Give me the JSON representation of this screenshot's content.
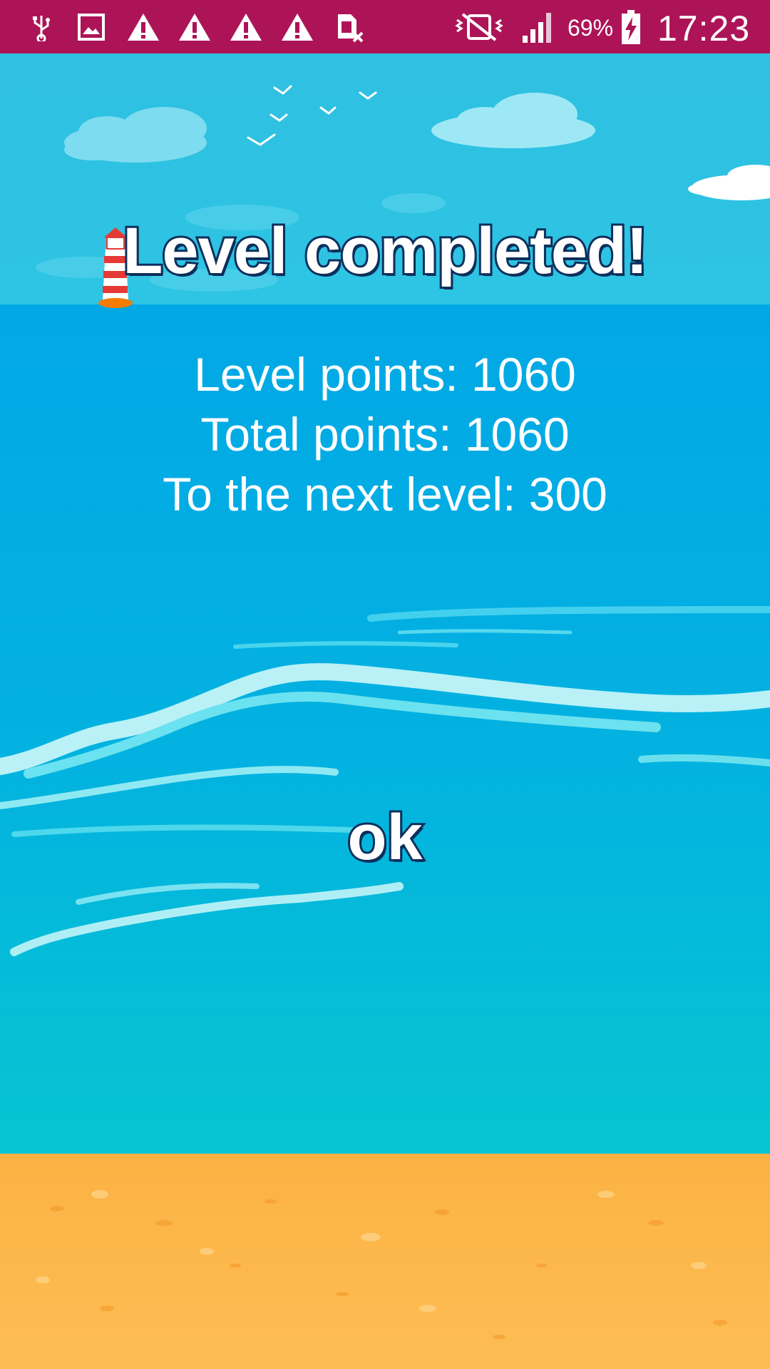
{
  "status_bar": {
    "background": "#ad1457",
    "battery_percent": "69%",
    "time": "17:23",
    "icons": [
      "usb-icon",
      "image-icon",
      "warning-icon",
      "warning-icon",
      "warning-icon",
      "warning-icon",
      "sim-error-icon",
      "vibrate-icon",
      "signal-icon",
      "battery-charging-icon"
    ]
  },
  "dialog": {
    "title": "Level completed!",
    "level_points": "Level points: 1060",
    "total_points": "Total points: 1060",
    "next_level": "To the next level: 300",
    "ok_label": "ok"
  },
  "colors": {
    "sky": "#2cc2e1",
    "sea": "#03a9e4",
    "sea_shallow": "#05c6d1",
    "sand": "#fbb447",
    "title_outline": "#0d2f5c"
  }
}
